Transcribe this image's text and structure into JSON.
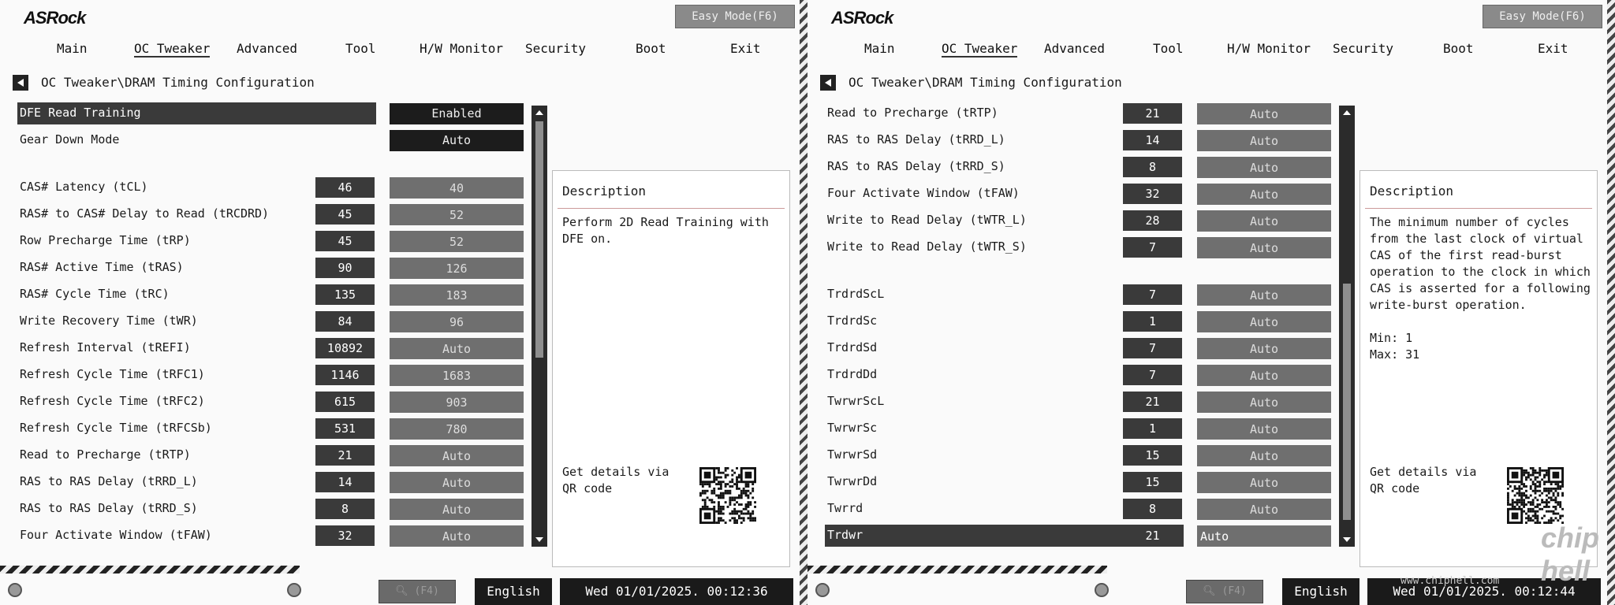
{
  "header": {
    "logo": "ASRock",
    "easy_mode": "Easy Mode(F6)",
    "menu": [
      "Main",
      "OC Tweaker",
      "Advanced",
      "Tool",
      "H/W Monitor",
      "Security",
      "Boot",
      "Exit"
    ],
    "active_tab": "OC Tweaker",
    "breadcrumb": "OC Tweaker\\DRAM Timing Configuration"
  },
  "left_panel": {
    "rows": [
      {
        "label": "DFE Read Training",
        "current": "",
        "value": "Enabled",
        "selected": true,
        "style": "dark"
      },
      {
        "label": "Gear Down Mode",
        "current": "",
        "value": "Auto",
        "selected": false,
        "style": "dark"
      },
      {
        "label": "CAS# Latency (tCL)",
        "current": "46",
        "value": "40"
      },
      {
        "label": "RAS# to CAS# Delay to Read  (tRCDRD)",
        "current": "45",
        "value": "52"
      },
      {
        "label": "Row Precharge Time (tRP)",
        "current": "45",
        "value": "52"
      },
      {
        "label": "RAS# Active Time (tRAS)",
        "current": "90",
        "value": "126"
      },
      {
        "label": "RAS# Cycle Time (tRC)",
        "current": "135",
        "value": "183"
      },
      {
        "label": "Write Recovery Time (tWR)",
        "current": "84",
        "value": "96"
      },
      {
        "label": "Refresh Interval (tREFI)",
        "current": "10892",
        "value": "Auto"
      },
      {
        "label": "Refresh Cycle Time (tRFC1)",
        "current": "1146",
        "value": "1683"
      },
      {
        "label": "Refresh Cycle Time (tRFC2)",
        "current": "615",
        "value": "903"
      },
      {
        "label": "Refresh Cycle Time (tRFCSb)",
        "current": "531",
        "value": "780"
      },
      {
        "label": "Read to Precharge (tRTP)",
        "current": "21",
        "value": "Auto"
      },
      {
        "label": "RAS to RAS Delay (tRRD_L)",
        "current": "14",
        "value": "Auto"
      },
      {
        "label": "RAS to RAS Delay (tRRD_S)",
        "current": "8",
        "value": "Auto"
      },
      {
        "label": "Four Activate Window (tFAW)",
        "current": "32",
        "value": "Auto"
      }
    ],
    "description_title": "Description",
    "description": "Perform 2D Read Training with DFE on.",
    "qr_text": "Get details via QR code",
    "search": "(F4)",
    "language": "English",
    "datetime": "Wed 01/01/2025. 00:12:36"
  },
  "right_panel": {
    "rows": [
      {
        "label": "Read to Precharge (tRTP)",
        "current": "21",
        "value": "Auto"
      },
      {
        "label": "RAS to RAS Delay (tRRD_L)",
        "current": "14",
        "value": "Auto"
      },
      {
        "label": "RAS to RAS Delay (tRRD_S)",
        "current": "8",
        "value": "Auto"
      },
      {
        "label": "Four Activate Window (tFAW)",
        "current": "32",
        "value": "Auto"
      },
      {
        "label": "Write to Read Delay (tWTR_L)",
        "current": "28",
        "value": "Auto"
      },
      {
        "label": "Write to Read Delay (tWTR_S)",
        "current": "7",
        "value": "Auto"
      },
      {
        "label": "TrdrdScL",
        "current": "7",
        "value": "Auto"
      },
      {
        "label": "TrdrdSc",
        "current": "1",
        "value": "Auto"
      },
      {
        "label": "TrdrdSd",
        "current": "7",
        "value": "Auto"
      },
      {
        "label": "TrdrdDd",
        "current": "7",
        "value": "Auto"
      },
      {
        "label": "TwrwrScL",
        "current": "21",
        "value": "Auto"
      },
      {
        "label": "TwrwrSc",
        "current": "1",
        "value": "Auto"
      },
      {
        "label": "TwrwrSd",
        "current": "15",
        "value": "Auto"
      },
      {
        "label": "TwrwrDd",
        "current": "15",
        "value": "Auto"
      },
      {
        "label": "Twrrd",
        "current": "8",
        "value": "Auto"
      },
      {
        "label": "Trdwr",
        "current": "21",
        "value": "Auto",
        "selected": true,
        "style": "edit"
      }
    ],
    "description_title": "Description",
    "description": "The minimum number of cycles from the last clock of virtual CAS of the first read-burst operation to the clock in which CAS is asserted for a following write-burst operation.\n\nMin: 1\nMax: 31",
    "qr_text": "Get details via QR code",
    "search": "(F4)",
    "language": "English",
    "datetime": "Wed 01/01/2025. 00:12:44"
  },
  "watermark": {
    "text": "chip hell",
    "url": "www.chiphell.com"
  }
}
